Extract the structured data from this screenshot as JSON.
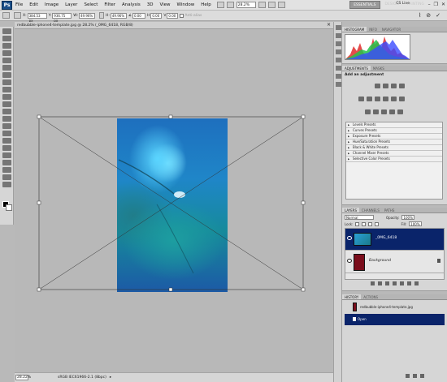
{
  "menubar": {
    "logo": "Ps",
    "menus": [
      "File",
      "Edit",
      "Image",
      "Layer",
      "Select",
      "Filter",
      "Analysis",
      "3D",
      "View",
      "Window",
      "Help"
    ],
    "zoom": "28.2%",
    "workspaces": [
      "ESSENTIALS",
      "DESIGN",
      "PAINTING"
    ],
    "cslive": "CS Live"
  },
  "options": {
    "x_label": "X:",
    "x_value": "384.53 px",
    "y_label": "Y:",
    "y_value": "936.75 px",
    "w_label": "W:",
    "w_value": "49.96%",
    "h_label": "H:",
    "h_value": "49.96%",
    "angle_value": "0.00",
    "h_skew": "0.00",
    "v_skew": "0.00",
    "antialias_label": "Anti-alias"
  },
  "document": {
    "title": "redbubble-iphone4-template.jpg @ 28.2% (_0MG_6418, RGB/8)",
    "close": "×"
  },
  "status": {
    "zoom": "28.22%",
    "profile": "sRGB IEC61966-2.1 (8bpc)"
  },
  "histogram_panel": {
    "tabs": [
      "HISTOGRAM",
      "INFO",
      "NAVIGATOR"
    ]
  },
  "adjustments_panel": {
    "tabs": [
      "ADJUSTMENTS",
      "MASKS"
    ],
    "title": "Add an adjustment",
    "presets": [
      "Levels Presets",
      "Curves Presets",
      "Exposure Presets",
      "Hue/Saturation Presets",
      "Black & White Presets",
      "Channel Mixer Presets",
      "Selective Color Presets"
    ]
  },
  "layers_panel": {
    "tabs": [
      "LAYERS",
      "CHANNELS",
      "PATHS"
    ],
    "blend_mode": "Normal",
    "opacity_label": "Opacity:",
    "opacity": "100%",
    "lock_label": "Lock:",
    "fill_label": "Fill:",
    "fill": "100%",
    "layers": [
      {
        "name": "_0MG_6418",
        "selected": true
      },
      {
        "name": "Background",
        "selected": false
      }
    ]
  },
  "history_panel": {
    "tabs": [
      "HISTORY",
      "ACTIONS"
    ],
    "items": [
      {
        "label": "redbubble-iphone4-template.jpg",
        "selected": false
      },
      {
        "label": "Open",
        "selected": true
      }
    ]
  },
  "colors": {
    "selection": "#0a246a",
    "ps_blue": "#1b4e88",
    "canvas_bg": "#b8b8b8"
  }
}
